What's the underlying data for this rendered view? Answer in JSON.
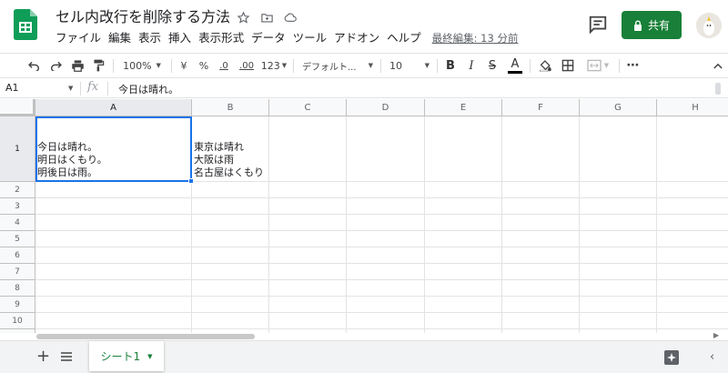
{
  "header": {
    "title": "セル内改行を削除する方法",
    "menu": [
      "ファイル",
      "編集",
      "表示",
      "挿入",
      "表示形式",
      "データ",
      "ツール",
      "アドオン",
      "ヘルプ"
    ],
    "last_edit": "最終編集: 13 分前",
    "share_label": "共有"
  },
  "toolbar": {
    "zoom": "100%",
    "currency": "¥",
    "percent": "%",
    "decrease_decimal": ".0",
    "increase_decimal": ".00",
    "number_format": "123",
    "font": "デフォルト...",
    "font_size": "10",
    "bold": "B",
    "italic": "I",
    "strike": "S",
    "text_color": "A",
    "text_color_value": "#000000"
  },
  "formula_bar": {
    "name_box": "A1",
    "fx": "fx",
    "content": "今日は晴れ。"
  },
  "grid": {
    "columns": [
      "A",
      "B",
      "C",
      "D",
      "E",
      "F",
      "G",
      "H"
    ],
    "rows": [
      "1",
      "2",
      "3",
      "4",
      "5",
      "6",
      "7",
      "8",
      "9",
      "10"
    ],
    "cells": {
      "A1": "今日は晴れ。\n明日はくもり。\n明後日は雨。",
      "B1": "東京は晴れ\n大阪は雨\n名古屋はくもり"
    },
    "selected_cell": "A1"
  },
  "sheets": {
    "tabs": [
      "シート1"
    ],
    "active": "シート1"
  },
  "colors": {
    "accent_green": "#188038",
    "selection_blue": "#1a73e8",
    "header_bg": "#f8f9fa"
  }
}
